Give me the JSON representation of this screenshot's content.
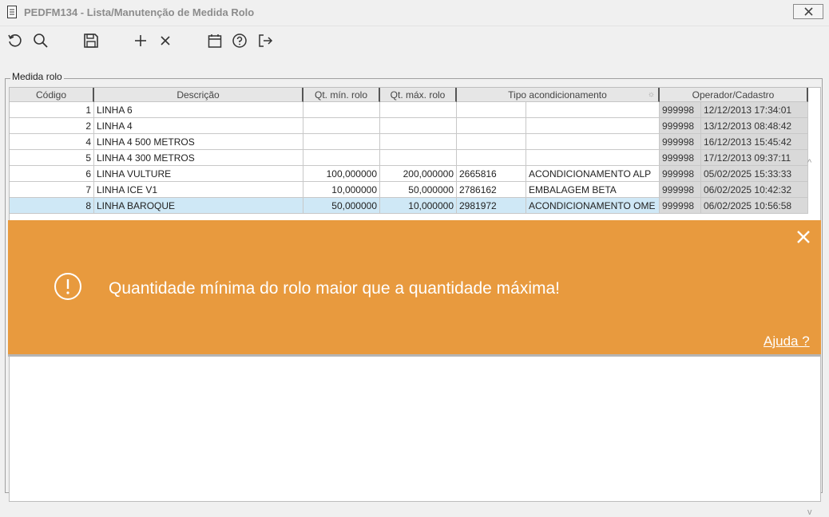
{
  "window": {
    "title": "PEDFM134 - Lista/Manutenção de Medida Rolo"
  },
  "group": {
    "label": "Medida rolo"
  },
  "columns": [
    "Código",
    "Descrição",
    "Qt. mín. rolo",
    "Qt. máx. rolo",
    "Tipo acondicionamento",
    "Operador/Cadastro"
  ],
  "rows": [
    {
      "codigo": "1",
      "descricao": "LINHA 6",
      "qt_min": "",
      "qt_max": "",
      "tipo_codigo": "",
      "tipo_descricao": "",
      "operador": "999998",
      "cadastro": "12/12/2013 17:34:01"
    },
    {
      "codigo": "2",
      "descricao": "LINHA 4",
      "qt_min": "",
      "qt_max": "",
      "tipo_codigo": "",
      "tipo_descricao": "",
      "operador": "999998",
      "cadastro": "13/12/2013 08:48:42"
    },
    {
      "codigo": "4",
      "descricao": "LINHA 4 500 METROS",
      "qt_min": "",
      "qt_max": "",
      "tipo_codigo": "",
      "tipo_descricao": "",
      "operador": "999998",
      "cadastro": "16/12/2013 15:45:42"
    },
    {
      "codigo": "5",
      "descricao": "LINHA 4 300 METROS",
      "qt_min": "",
      "qt_max": "",
      "tipo_codigo": "",
      "tipo_descricao": "",
      "operador": "999998",
      "cadastro": "17/12/2013 09:37:11"
    },
    {
      "codigo": "6",
      "descricao": "LINHA VULTURE",
      "qt_min": "100,000000",
      "qt_max": "200,000000",
      "tipo_codigo": "2665816",
      "tipo_descricao": "ACONDICIONAMENTO ALP",
      "operador": "999998",
      "cadastro": "05/02/2025 15:33:33"
    },
    {
      "codigo": "7",
      "descricao": "LINHA ICE V1",
      "qt_min": "10,000000",
      "qt_max": "50,000000",
      "tipo_codigo": "2786162",
      "tipo_descricao": "EMBALAGEM BETA",
      "operador": "999998",
      "cadastro": "06/02/2025 10:42:32"
    },
    {
      "codigo": "8",
      "descricao": "LINHA BAROQUE",
      "qt_min": "50,000000",
      "qt_max": "10,000000",
      "tipo_codigo": "2981972",
      "tipo_descricao": "ACONDICIONAMENTO OME",
      "operador": "999998",
      "cadastro": "06/02/2025 10:56:58"
    }
  ],
  "toast": {
    "message": "Quantidade mínima do rolo maior que a quantidade máxima!",
    "help": "Ajuda ?",
    "color": "#e89a3e"
  },
  "toolbar": {
    "icons": [
      "refresh-icon",
      "search-icon",
      "save-icon",
      "add-icon",
      "delete-icon",
      "calendar-icon",
      "help-icon",
      "exit-icon"
    ]
  }
}
